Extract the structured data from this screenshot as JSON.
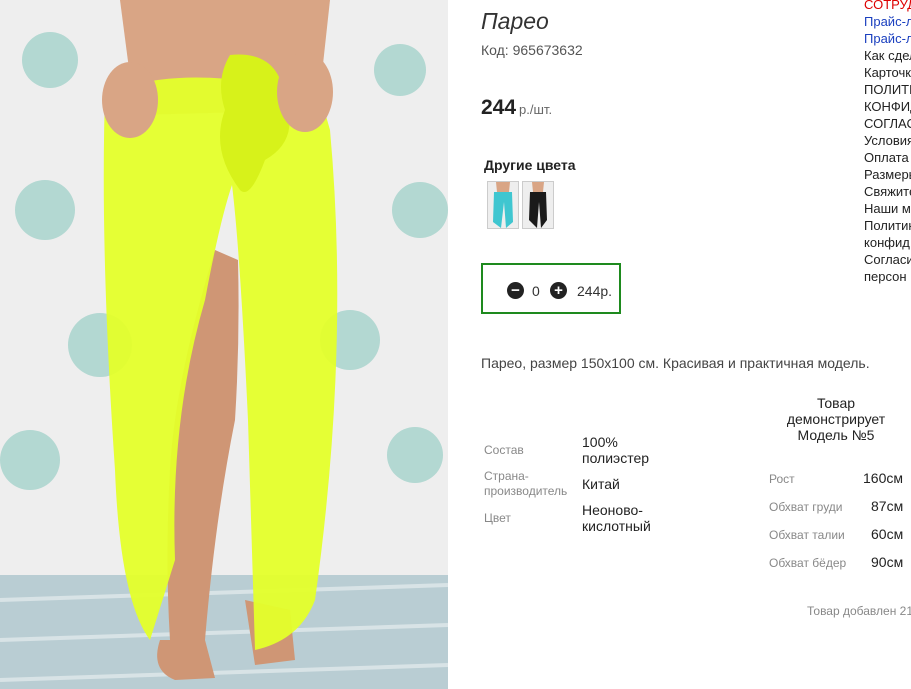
{
  "product": {
    "title": "Парео",
    "code": "Код: 965673632",
    "price": "244",
    "price_unit": "р./шт.",
    "description": "Парео, размер 150х100 см. Красивая и практичная модель."
  },
  "colors": {
    "title": "Другие цвета",
    "swatches": [
      {
        "name": "turquoise",
        "color": "#3fc6d0"
      },
      {
        "name": "black",
        "color": "#1a1a1a"
      }
    ]
  },
  "cart": {
    "minus": "−",
    "plus": "+",
    "quantity": "0",
    "price": "244р."
  },
  "attributes": [
    {
      "label": "Состав",
      "value": "100% полиэстер"
    },
    {
      "label": "Страна-производитель",
      "value": "Китай"
    },
    {
      "label": "Цвет",
      "value": "Неоново-кислотный"
    }
  ],
  "model": {
    "heading": "Товар демонстрирует Модель №5",
    "rows": [
      {
        "label": "Рост",
        "value": "160см"
      },
      {
        "label": "Обхват груди",
        "value": "87см"
      },
      {
        "label": "Обхват талии",
        "value": "60см"
      },
      {
        "label": "Обхват бёдер",
        "value": "90см"
      }
    ]
  },
  "added_text": "Товар добавлен 21",
  "sidebar_links": [
    {
      "text": "СОТРУДНИЧЕСТВО",
      "style": "red"
    },
    {
      "text": "Прайс-лист",
      "style": "blue"
    },
    {
      "text": "Прайс-лист",
      "style": "blue"
    },
    {
      "text": "Как сделать заказ",
      "style": "blk"
    },
    {
      "text": "Карточка",
      "style": "blk"
    },
    {
      "text": "ПОЛИТИКА",
      "style": "blk"
    },
    {
      "text": "КОНФИДЕНЦИАЛЬНОСТИ",
      "style": "blk"
    },
    {
      "text": "СОГЛАСИЕ",
      "style": "blk"
    },
    {
      "text": "Условия",
      "style": "blk"
    },
    {
      "text": "Оплата",
      "style": "blk"
    },
    {
      "text": "Размеры",
      "style": "blk"
    },
    {
      "text": "Свяжитесь",
      "style": "blk"
    },
    {
      "text": "Наши м",
      "style": "blk"
    },
    {
      "text": "Политика",
      "style": "blk"
    },
    {
      "text": "конфид",
      "style": "blk"
    },
    {
      "text": "Согласие",
      "style": "blk"
    },
    {
      "text": "персон",
      "style": "blk"
    }
  ],
  "accent": {
    "neon": "#e4ff2a",
    "cart_border": "#1e8a1e"
  }
}
